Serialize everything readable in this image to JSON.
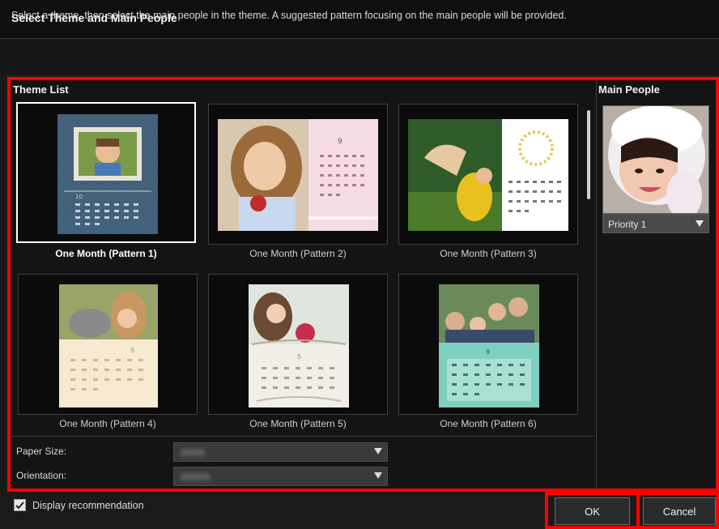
{
  "dialog": {
    "title": "Select Theme and Main People",
    "description": "Select a theme, then select the main people in the theme. A suggested pattern focusing on the main people will be provided."
  },
  "theme_list": {
    "heading": "Theme List",
    "items": [
      {
        "label": "One Month (Pattern 1)",
        "selected": true
      },
      {
        "label": "One Month (Pattern 2)",
        "selected": false
      },
      {
        "label": "One Month (Pattern 3)",
        "selected": false
      },
      {
        "label": "One Month (Pattern 4)",
        "selected": false
      },
      {
        "label": "One Month (Pattern 5)",
        "selected": false
      },
      {
        "label": "One Month (Pattern 6)",
        "selected": false
      }
    ]
  },
  "settings": {
    "paper_size_label": "Paper Size:",
    "paper_size_value": "",
    "orientation_label": "Orientation:",
    "orientation_value": ""
  },
  "main_people": {
    "heading": "Main People",
    "priority": "Priority 1"
  },
  "footer": {
    "display_recommendation_label": "Display recommendation",
    "display_recommendation_checked": true,
    "ok_label": "OK",
    "cancel_label": "Cancel"
  },
  "colors": {
    "highlight_frame": "#ff0000",
    "dialog_background": "#1a1a1a",
    "selected_tile_border": "#ffffff"
  }
}
